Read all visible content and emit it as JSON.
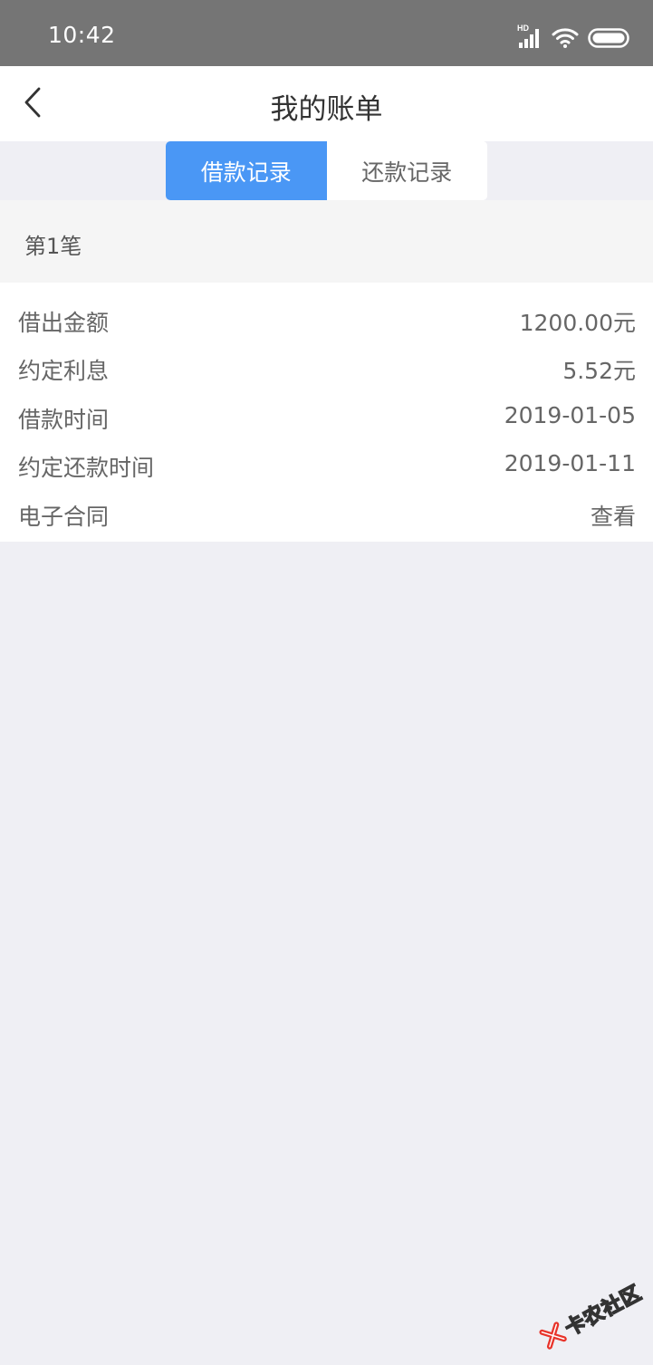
{
  "status_bar": {
    "time": "10:42",
    "network_label": "HD",
    "icons": [
      "signal-icon",
      "wifi-icon",
      "battery-icon"
    ]
  },
  "nav": {
    "title": "我的账单",
    "back_icon": "chevron-left-icon"
  },
  "tabs": [
    {
      "label": "借款记录",
      "active": true
    },
    {
      "label": "还款记录",
      "active": false
    }
  ],
  "loan": {
    "header": "第1笔",
    "rows": [
      {
        "label": "借出金额",
        "value": "1200.00元"
      },
      {
        "label": "约定利息",
        "value": "5.52元"
      },
      {
        "label": "借款时间",
        "value": "2019-01-05"
      },
      {
        "label": "约定还款时间",
        "value": "2019-01-11"
      },
      {
        "label": "电子合同",
        "value": "查看"
      }
    ]
  },
  "watermark": {
    "text": "卡农社区"
  },
  "colors": {
    "accent": "#4a97f5",
    "status_bar": "#757575",
    "background": "#efeff4"
  }
}
